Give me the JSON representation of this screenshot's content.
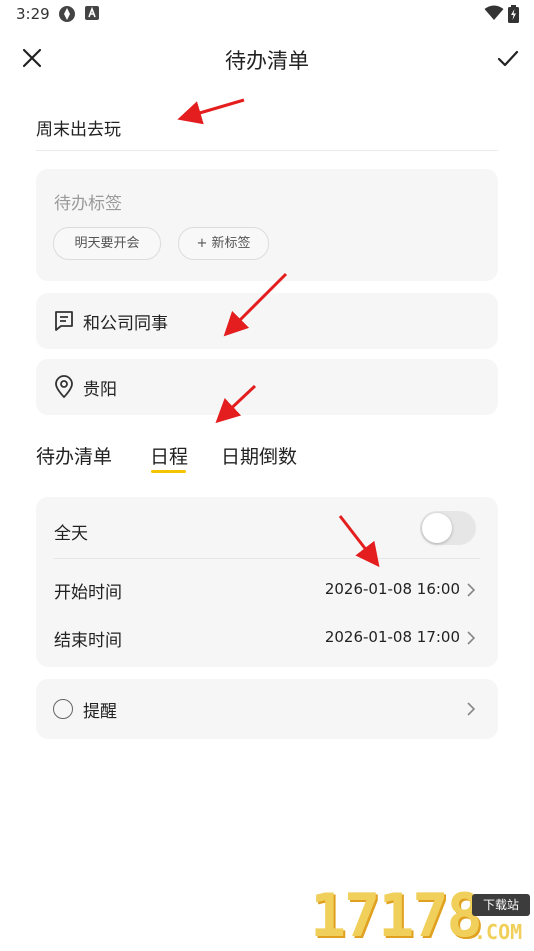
{
  "status_bar": {
    "time": "3:29"
  },
  "header": {
    "title": "待办清单"
  },
  "task": {
    "title_value": "周末出去玩"
  },
  "tags": {
    "label": "待办标签",
    "chips": [
      "明天要开会",
      "+ 新标签"
    ]
  },
  "note": {
    "text": "和公司同事"
  },
  "location": {
    "text": "贵阳"
  },
  "tabs": [
    "待办清单",
    "日程",
    "日期倒数"
  ],
  "selected_tab": "日程",
  "schedule": {
    "all_day_label": "全天",
    "all_day_on": false,
    "start_label": "开始时间",
    "start_value": "2026-01-08 16:00",
    "end_label": "结束时间",
    "end_value": "2026-01-08 17:00"
  },
  "reminder": {
    "label": "提醒"
  },
  "watermark": {
    "digits": "17178",
    "badge": "下载站",
    "suffix": ".COM"
  },
  "colors": {
    "accent": "#f5c400",
    "annotation_arrow": "#e41e1e",
    "card_bg": "#f6f6f6"
  }
}
